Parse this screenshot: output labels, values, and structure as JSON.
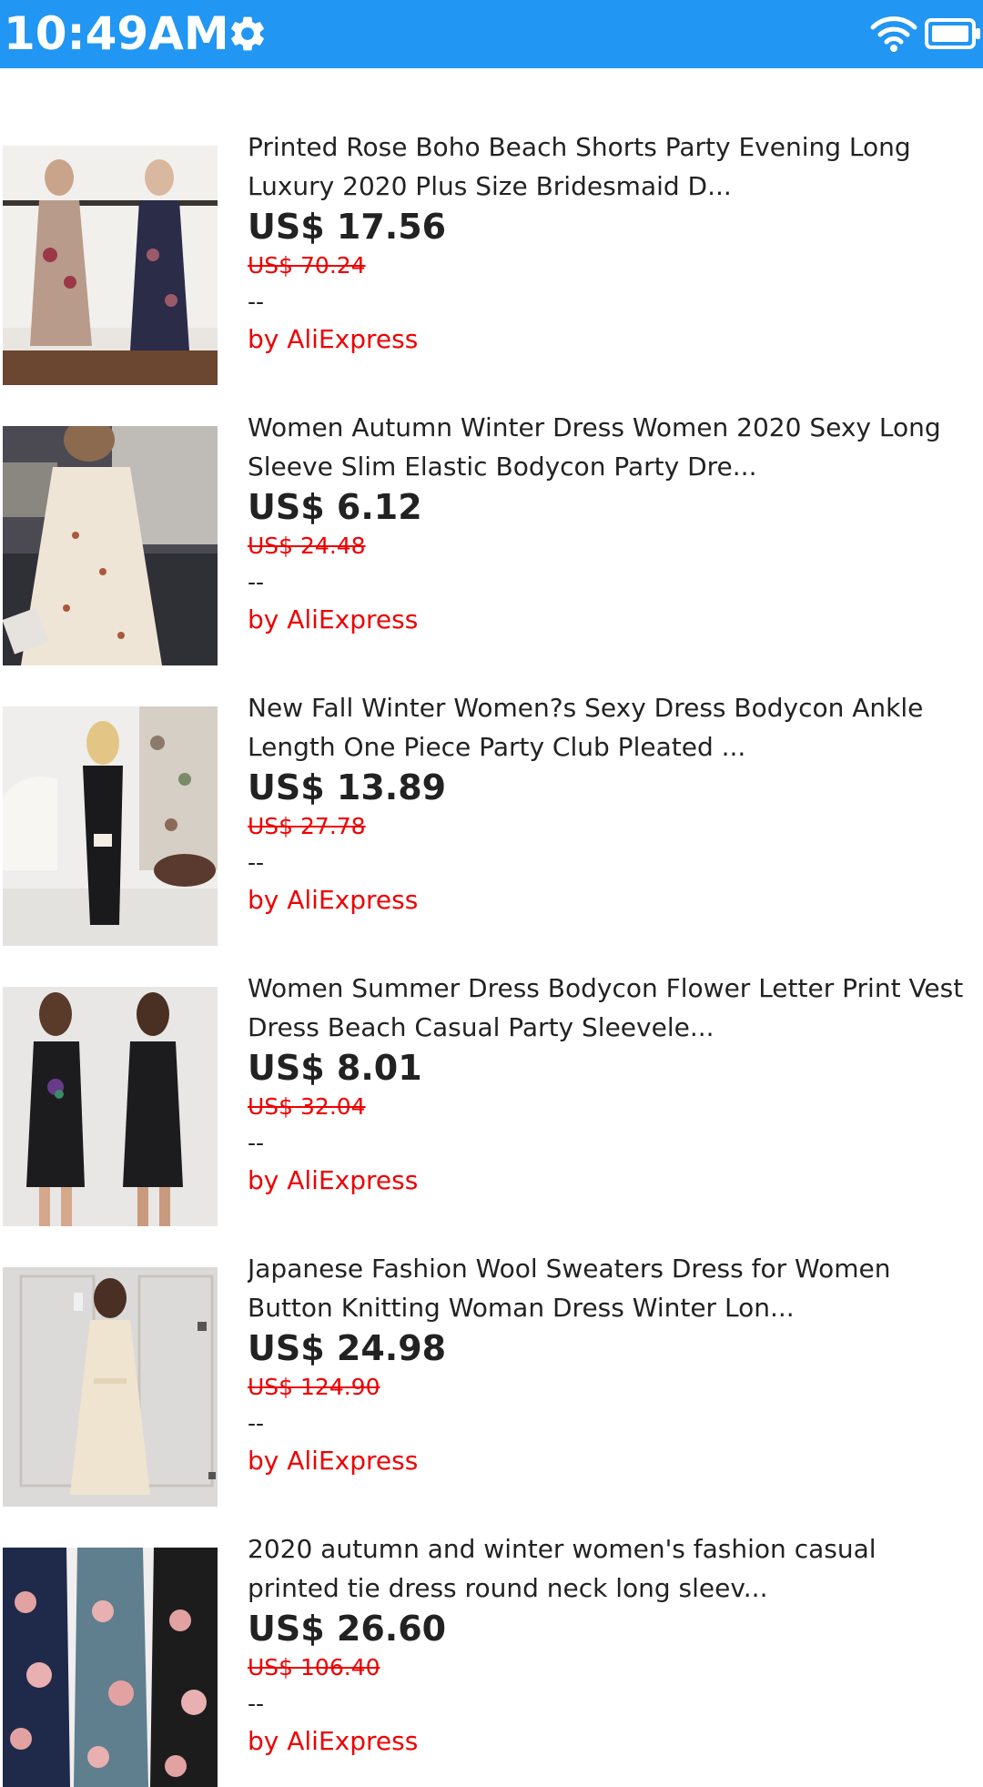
{
  "status_bar": {
    "time": "10:49AM",
    "settings_icon": "gear-icon",
    "wifi_icon": "wifi-icon",
    "battery_icon": "battery-icon",
    "background": "#2196F3"
  },
  "products": [
    {
      "title": "Printed Rose Boho Beach Shorts Party Evening Long Luxury 2020 Plus Size Bridesmaid D...",
      "price": "US$ 17.56",
      "original_price": "US$ 70.24",
      "rating": "--",
      "seller": "by AliExpress"
    },
    {
      "title": "Women Autumn Winter Dress Women 2020 Sexy Long Sleeve Slim Elastic Bodycon Party Dre...",
      "price": "US$ 6.12",
      "original_price": "US$ 24.48",
      "rating": "--",
      "seller": "by AliExpress"
    },
    {
      "title": "New Fall Winter Women?s Sexy Dress Bodycon Ankle Length One Piece Party Club Pleated ...",
      "price": "US$ 13.89",
      "original_price": "US$ 27.78",
      "rating": "--",
      "seller": "by AliExpress"
    },
    {
      "title": "Women Summer Dress Bodycon Flower Letter Print Vest Dress Beach Casual Party Sleevele...",
      "price": "US$ 8.01",
      "original_price": "US$ 32.04",
      "rating": "--",
      "seller": "by AliExpress"
    },
    {
      "title": "Japanese Fashion Wool Sweaters Dress for Women Button Knitting Woman Dress Winter Lon...",
      "price": "US$ 24.98",
      "original_price": "US$ 124.90",
      "rating": "--",
      "seller": "by AliExpress"
    },
    {
      "title": "2020 autumn and winter women's fashion casual printed tie dress round neck long sleev...",
      "price": "US$ 26.60",
      "original_price": "US$ 106.40",
      "rating": "--",
      "seller": "by AliExpress"
    }
  ],
  "colors": {
    "accent_red": "#ee0000",
    "text": "#222222"
  }
}
